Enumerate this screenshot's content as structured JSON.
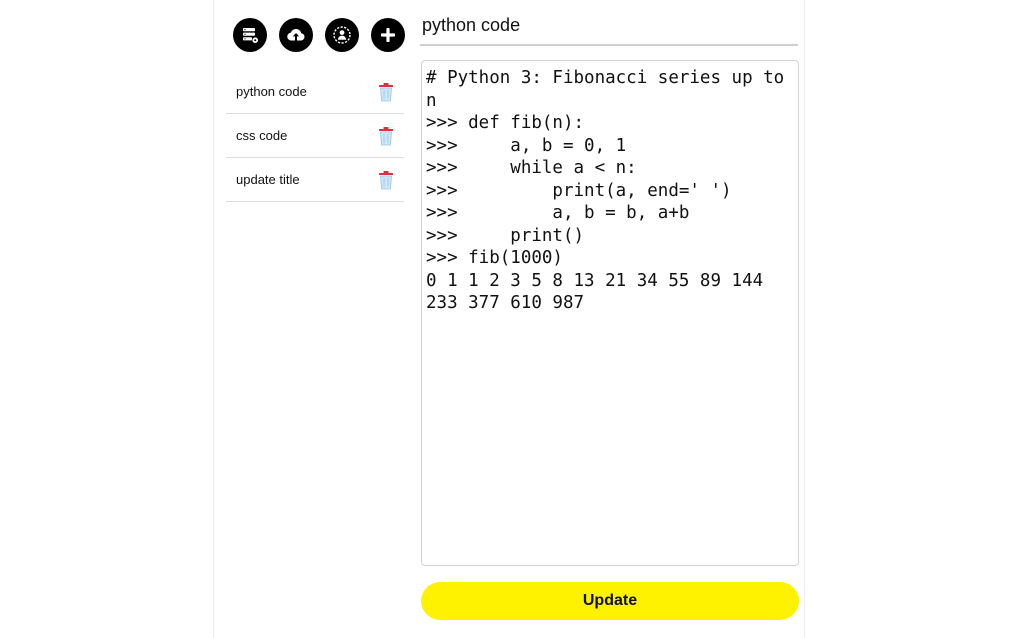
{
  "toolbar": {
    "icons": [
      "database-icon",
      "cloud-upload-icon",
      "user-settings-icon",
      "plus-icon"
    ]
  },
  "notes": [
    {
      "label": "python code"
    },
    {
      "label": "css code"
    },
    {
      "label": "update title"
    }
  ],
  "editor": {
    "title_value": "python code",
    "content": "# Python 3: Fibonacci series up to n\n>>> def fib(n):\n>>>     a, b = 0, 1\n>>>     while a < n:\n>>>         print(a, end=' ')\n>>>         a, b = b, a+b\n>>>     print()\n>>> fib(1000)\n0 1 1 2 3 5 8 13 21 34 55 89 144 233 377 610 987",
    "update_label": "Update"
  },
  "colors": {
    "accent": "#fff200",
    "trash": "#e0303a"
  }
}
